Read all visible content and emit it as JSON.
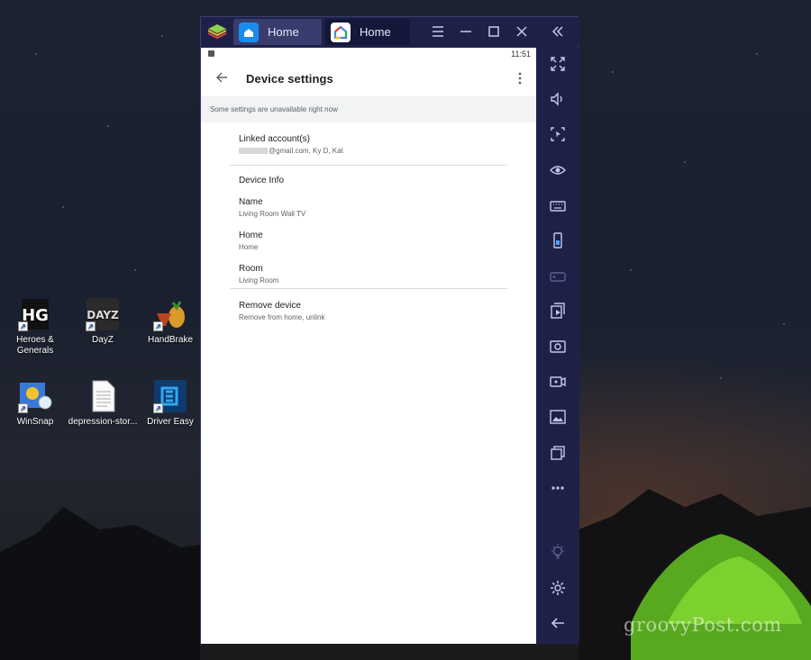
{
  "desktop": {
    "icons": [
      {
        "label": "Heroes &\nGenerals",
        "icon": "heroes-generals-icon"
      },
      {
        "label": "DayZ",
        "icon": "dayz-icon"
      },
      {
        "label": "HandBrake",
        "icon": "handbrake-icon"
      },
      {
        "label": "WinSnap",
        "icon": "winsnap-icon"
      },
      {
        "label": "depression-stor...",
        "icon": "document-icon"
      },
      {
        "label": "Driver Easy",
        "icon": "driver-easy-icon"
      }
    ],
    "watermark": "groovyPost.com"
  },
  "emulator": {
    "tabs": [
      {
        "label": "Home",
        "icon": "bluestacks-home-icon"
      },
      {
        "label": "Home",
        "icon": "google-home-icon"
      }
    ],
    "status_time": "11:51",
    "sidebar_icons": [
      "fullscreen-icon",
      "volume-icon",
      "screen-select-icon",
      "eye-icon",
      "keyboard-icon",
      "phone-icon",
      "gamepad-icon",
      "install-apk-icon",
      "camera-icon",
      "record-icon",
      "media-icon",
      "multi-instance-icon",
      "more-icon",
      "bulb-icon",
      "settings-icon",
      "back-icon"
    ]
  },
  "app": {
    "title": "Device settings",
    "banner": "Some settings are unavailable right now",
    "linked": {
      "title": "Linked account(s)",
      "subtitle": "@gmail.com, Ky D, Kat"
    },
    "device_info_heading": "Device Info",
    "name": {
      "title": "Name",
      "subtitle": "Living Room Wall TV"
    },
    "home": {
      "title": "Home",
      "subtitle": "Home"
    },
    "room": {
      "title": "Room",
      "subtitle": "Living Room"
    },
    "remove": {
      "title": "Remove device",
      "subtitle": "Remove from home, unlink"
    }
  },
  "colors": {
    "emulator_chrome": "#1e2147",
    "active_tab": "#383d6e",
    "banner_bg": "#f1f3f4"
  }
}
